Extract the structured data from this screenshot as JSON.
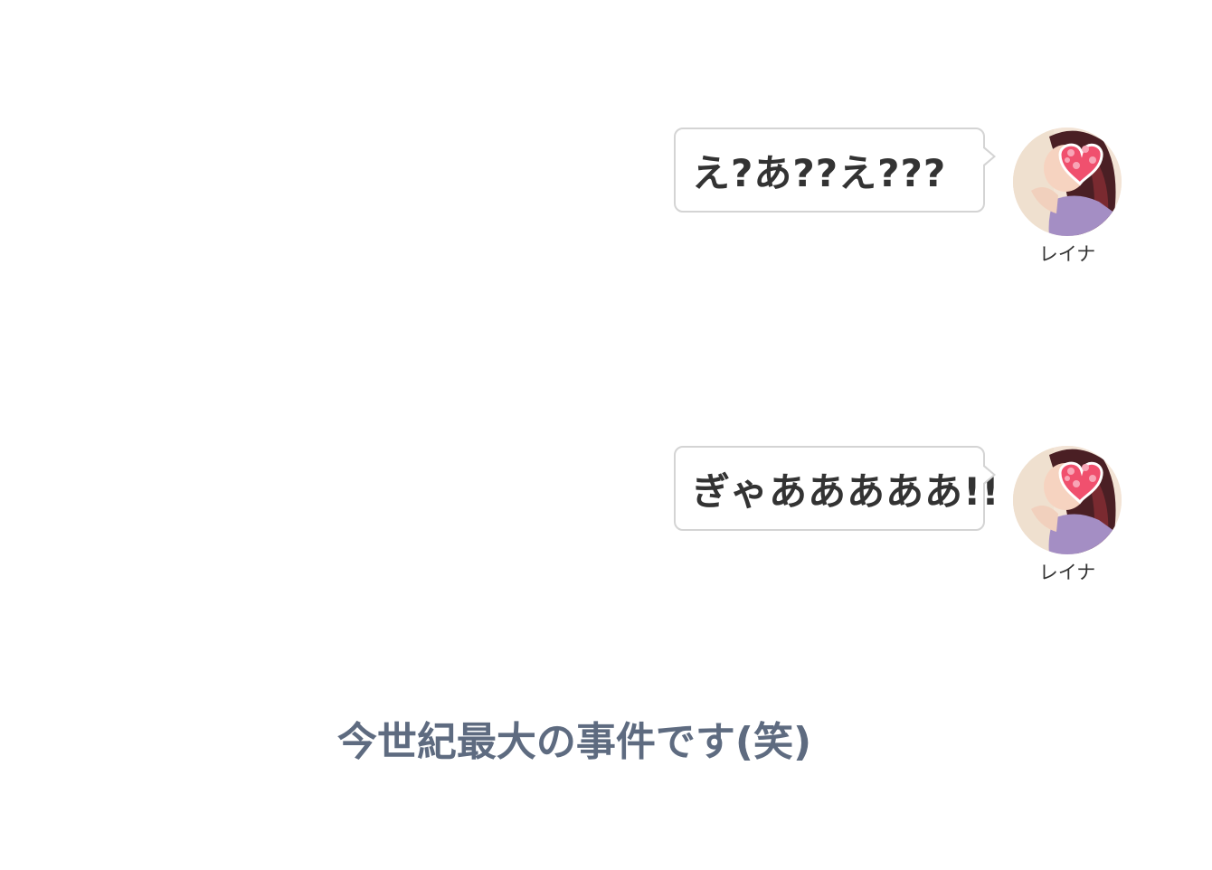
{
  "messages": [
    {
      "text": "え?あ??え???",
      "speaker": "レイナ",
      "avatar_icon": "avatar-photo-heart-icon"
    },
    {
      "text": "ぎゃあああああ!!",
      "speaker": "レイナ",
      "avatar_icon": "avatar-photo-heart-icon"
    }
  ],
  "caption": "今世紀最大の事件です(笑)",
  "colors": {
    "bubble_border": "#d4d4d4",
    "bubble_text": "#333333",
    "caption_text": "#5e6b80",
    "heart": "#f0506e"
  }
}
